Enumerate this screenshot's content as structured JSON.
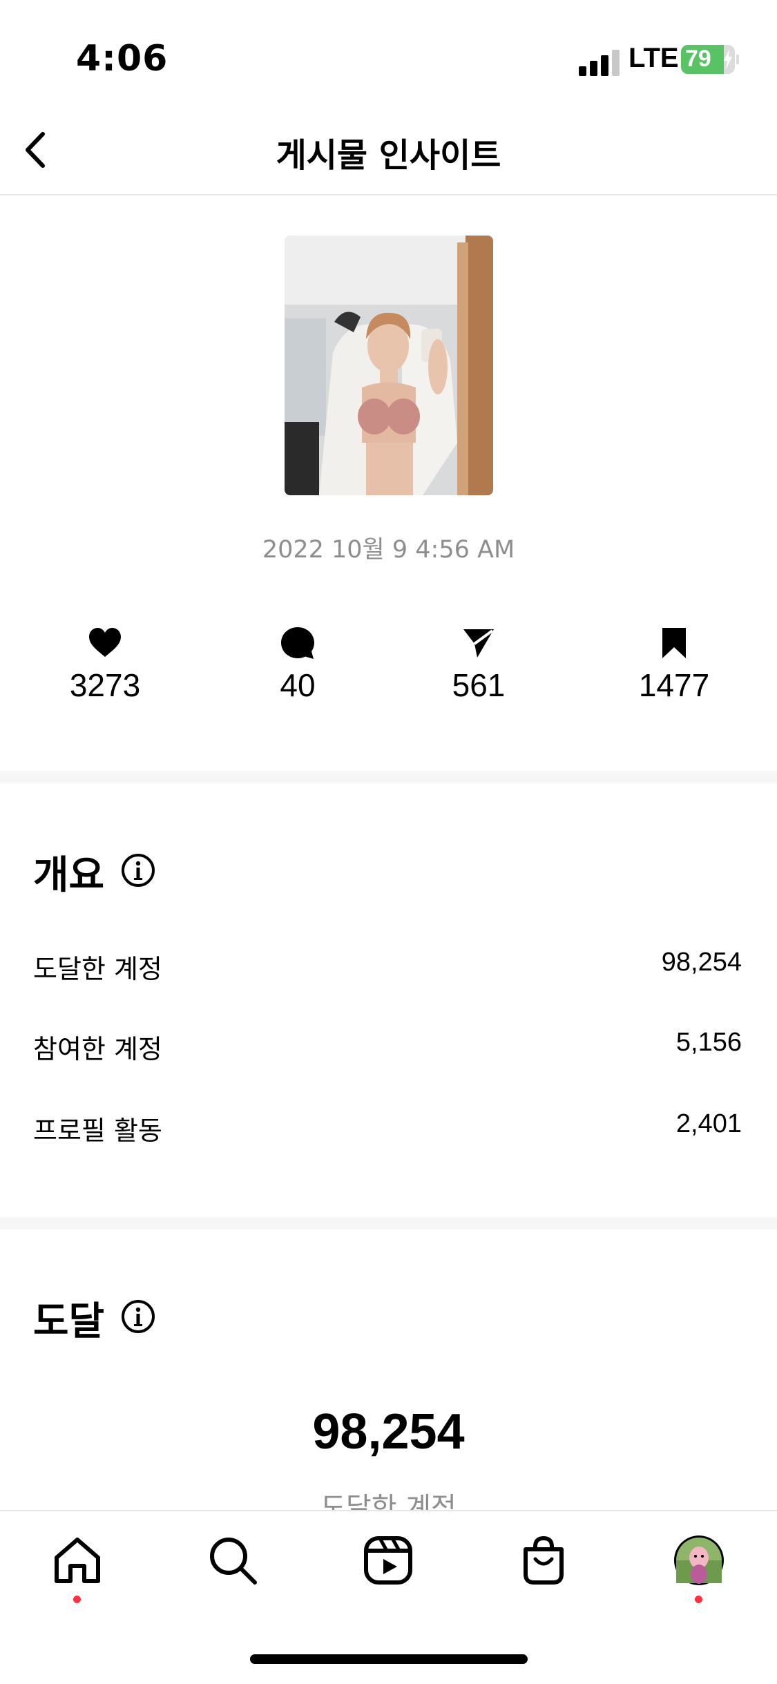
{
  "status_bar": {
    "time": "4:06",
    "network": "LTE",
    "battery": "79",
    "battery_level": 0.79
  },
  "header": {
    "title": "게시물 인사이트"
  },
  "post": {
    "date": "2022 10월 9 4:56 AM",
    "stats": [
      {
        "icon": "heart-icon",
        "value": "3273"
      },
      {
        "icon": "comment-icon",
        "value": "40"
      },
      {
        "icon": "share-icon",
        "value": "561"
      },
      {
        "icon": "bookmark-icon",
        "value": "1477"
      }
    ]
  },
  "overview": {
    "title": "개요",
    "rows": [
      {
        "label": "도달한 계정",
        "value": "98,254"
      },
      {
        "label": "참여한 계정",
        "value": "5,156"
      },
      {
        "label": "프로필 활동",
        "value": "2,401"
      }
    ]
  },
  "reach": {
    "title": "도달",
    "total": "98,254",
    "subtitle": "도달한 계정"
  },
  "colors": {
    "accent_dot": "#ff3040",
    "battery_green": "#58c264",
    "muted": "#8e8e8e"
  }
}
